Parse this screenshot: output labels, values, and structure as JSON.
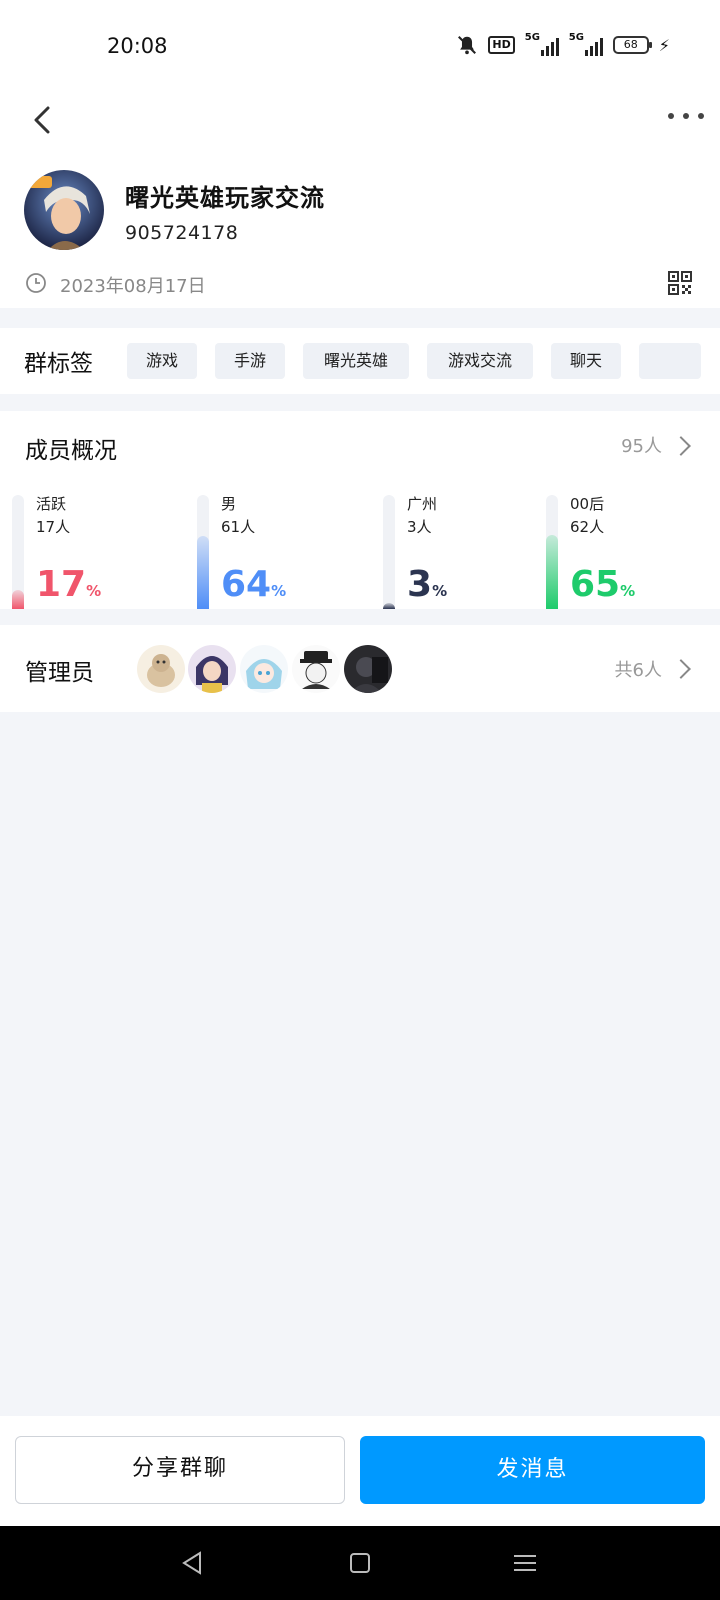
{
  "status_bar": {
    "time": "20:08",
    "hd_label": "HD",
    "sim1_label": "5G",
    "sim2_label": "5G",
    "battery": "68",
    "icons": [
      "mute-bell-icon",
      "signal-icon",
      "signal-icon",
      "battery-icon",
      "charging-icon"
    ]
  },
  "header": {
    "group_name": "曙光英雄玩家交流",
    "group_id": "905724178",
    "created_date": "2023年08月17日"
  },
  "tags": {
    "title": "群标签",
    "items": [
      "游戏",
      "手游",
      "曙光英雄",
      "游戏交流",
      "聊天",
      ""
    ]
  },
  "members": {
    "title": "成员概况",
    "total": "95人",
    "stats": [
      {
        "label": "活跃",
        "count": "17人",
        "value": "17",
        "percent": 17,
        "color": "#f0556b"
      },
      {
        "label": "男",
        "count": "61人",
        "value": "64",
        "percent": 64,
        "color": "#4f8ef7"
      },
      {
        "label": "广州",
        "count": "3人",
        "value": "3",
        "percent": 3,
        "color": "#2b3450"
      },
      {
        "label": "00后",
        "count": "62人",
        "value": "65",
        "percent": 65,
        "color": "#1ecb6b"
      }
    ],
    "percent_sign": "%"
  },
  "admins": {
    "title": "管理员",
    "total": "共6人"
  },
  "actions": {
    "share_label": "分享群聊",
    "send_label": "发消息"
  }
}
